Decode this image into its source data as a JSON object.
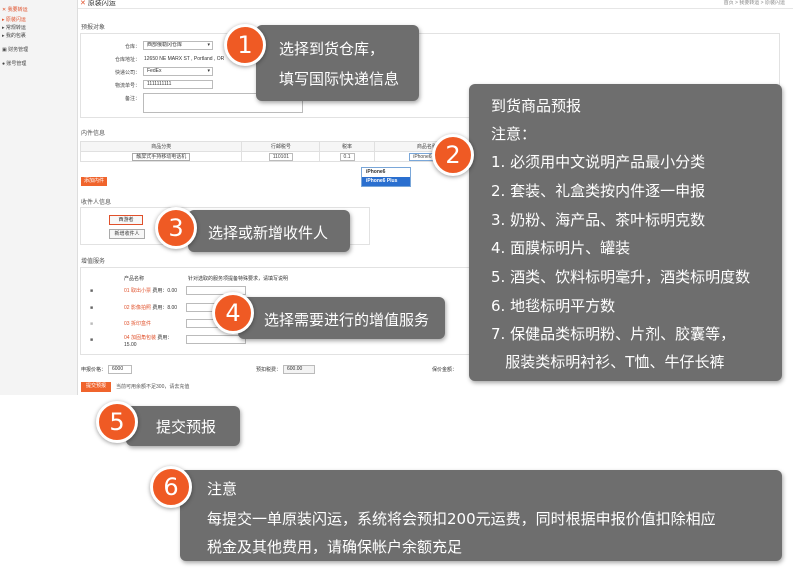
{
  "app": {
    "title": "原装闪运",
    "breadcrumb": "首页 > 我要转运 > 原装闪运"
  },
  "sidebar": {
    "items": [
      {
        "label": "我要转运"
      },
      {
        "label": "原装闪运"
      },
      {
        "label": "常规转运"
      },
      {
        "label": "我的包裹"
      },
      {
        "label": "财务管理"
      },
      {
        "label": "账号管理"
      }
    ]
  },
  "forecast": {
    "section_label": "预报对象",
    "warehouse_label": "仓库：",
    "warehouse_value": "西部俄勒冈仓库",
    "address_label": "仓库地址：",
    "address_value": "12650 NE MARX ST , Portland , OR",
    "carrier_label": "快递公司：",
    "carrier_value": "FedEx",
    "tracking_label": "物流单号：",
    "tracking_value": "1111111111",
    "remark_label": "备注："
  },
  "items": {
    "section_label": "内件信息",
    "headers": [
      "商品分类",
      "行邮税号",
      "税率",
      "商品名称"
    ],
    "row": {
      "category": "触屏式手持移动电话机",
      "tax_code": "110101",
      "rate": "0.1",
      "name": "iPhone6"
    },
    "dropdown_options": [
      "iPhone6",
      "iPhone6 Plus"
    ],
    "add_button": "添加内件"
  },
  "receiver": {
    "section_label": "收件人信息",
    "selected": "西游者",
    "add_button": "新增收件人"
  },
  "services": {
    "section_label": "增值服务",
    "headers": [
      "产品名称",
      "针对选取的服务项提备特殊要求，请填写说明"
    ],
    "rows": [
      {
        "name": "01 取出小票",
        "fee": "费用：0.00"
      },
      {
        "name": "02 影像拍照",
        "fee": "费用：8.00"
      },
      {
        "name": "03 拆印盒件",
        "fee": ""
      },
      {
        "name": "04 加固角包装",
        "fee": "费用：15.00"
      }
    ]
  },
  "footer": {
    "declared_label": "申报价格：",
    "declared_value": "6000",
    "prepay_label": "预扣税费：",
    "prepay_value": "600.00",
    "insured_label": "保价金额：",
    "submit_button": "提交预报",
    "note": "当前可用余额不足300，请去充值"
  },
  "callouts": [
    {
      "num": "1",
      "lines": [
        "选择到货仓库，",
        "填写国际快递信息"
      ]
    },
    {
      "num": "2",
      "lines": [
        "到货商品预报",
        "注意：",
        "1. 必须用中文说明产品最小分类",
        "2. 套装、礼盒类按内件逐一申报",
        "3. 奶粉、海产品、茶叶标明克数",
        "4. 面膜标明片、罐装",
        "5. 酒类、饮料标明毫升，酒类标明度数",
        "6. 地毯标明平方数",
        "7. 保健品类标明粉、片剂、胶囊等，",
        "   服装类标明衬衫、T恤、牛仔长裤"
      ]
    },
    {
      "num": "3",
      "lines": [
        "选择或新增收件人"
      ]
    },
    {
      "num": "4",
      "lines": [
        "选择需要进行的增值服务"
      ]
    },
    {
      "num": "5",
      "lines": [
        "提交预报"
      ]
    },
    {
      "num": "6",
      "lines": [
        "注意",
        "每提交一单原装闪运，系统将会预扣200元运费，同时根据申报价值扣除相应",
        "税金及其他费用，请确保帐户余额充足"
      ]
    }
  ],
  "colors": {
    "accent": "#ef5a24",
    "callout_bg": "#6e6e6e"
  }
}
